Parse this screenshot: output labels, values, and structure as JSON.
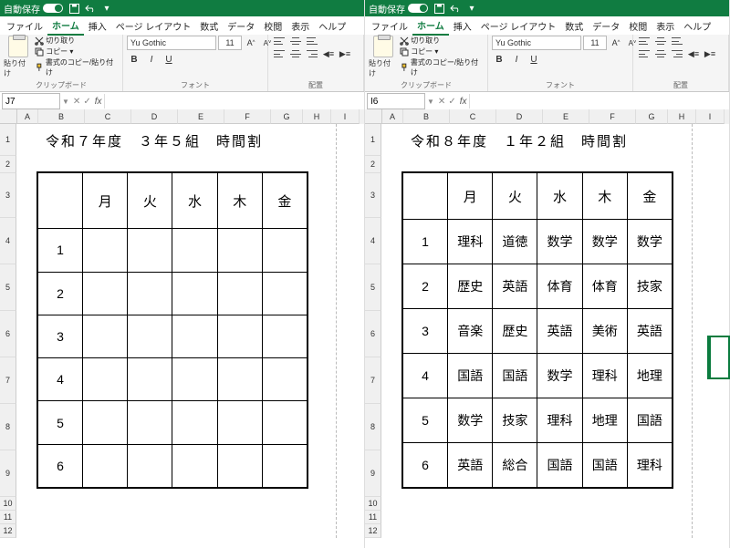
{
  "app": {
    "auto_save_label": "自動保存",
    "auto_save_state": "オン●"
  },
  "tabs": [
    "ファイル",
    "ホーム",
    "挿入",
    "ページ レイアウト",
    "数式",
    "データ",
    "校閲",
    "表示",
    "ヘルプ"
  ],
  "active_tab": "ホーム",
  "ribbon": {
    "clipboard_label": "クリップボード",
    "paste_label": "貼り付け",
    "cut": "切り取り",
    "copy": "コピー ▾",
    "format_painter": "書式のコピー/貼り付け",
    "font_label": "フォント",
    "font_name": "Yu Gothic",
    "font_size": "11",
    "bold": "B",
    "italic": "I",
    "underline": "U",
    "grow_font": "A^",
    "shrink_font": "A˅",
    "align_label": "配置"
  },
  "left": {
    "cell_ref": "J7",
    "title": "令和７年度　３年５組　時間割",
    "days": [
      "月",
      "火",
      "水",
      "木",
      "金"
    ],
    "periods": [
      "1",
      "2",
      "3",
      "4",
      "5",
      "6"
    ],
    "cells": [
      [
        "",
        "",
        "",
        "",
        ""
      ],
      [
        "",
        "",
        "",
        "",
        ""
      ],
      [
        "",
        "",
        "",
        "",
        ""
      ],
      [
        "",
        "",
        "",
        "",
        ""
      ],
      [
        "",
        "",
        "",
        "",
        ""
      ],
      [
        "",
        "",
        "",
        "",
        ""
      ]
    ]
  },
  "right": {
    "cell_ref": "I6",
    "title": "令和８年度　１年２組　時間割",
    "days": [
      "月",
      "火",
      "水",
      "木",
      "金"
    ],
    "periods": [
      "1",
      "2",
      "3",
      "4",
      "5",
      "6"
    ],
    "cells": [
      [
        "理科",
        "道徳",
        "数学",
        "数学",
        "数学"
      ],
      [
        "歴史",
        "英語",
        "体育",
        "体育",
        "技家"
      ],
      [
        "音楽",
        "歴史",
        "英語",
        "美術",
        "英語"
      ],
      [
        "国語",
        "国語",
        "数学",
        "理科",
        "地理"
      ],
      [
        "数学",
        "技家",
        "理科",
        "地理",
        "国語"
      ],
      [
        "英語",
        "総合",
        "国語",
        "国語",
        "理科"
      ]
    ]
  },
  "columns": [
    "A",
    "B",
    "C",
    "D",
    "E",
    "F",
    "G",
    "H",
    "I"
  ],
  "row_numbers": [
    "1",
    "2",
    "3",
    "4",
    "5",
    "6",
    "7",
    "8",
    "9",
    "10",
    "11",
    "12"
  ],
  "chart_data": {
    "type": "table",
    "tables": [
      {
        "title": "令和７年度　３年５組　時間割",
        "columns": [
          "",
          "月",
          "火",
          "水",
          "木",
          "金"
        ],
        "rows": [
          [
            "1",
            "",
            "",
            "",
            "",
            ""
          ],
          [
            "2",
            "",
            "",
            "",
            "",
            ""
          ],
          [
            "3",
            "",
            "",
            "",
            "",
            ""
          ],
          [
            "4",
            "",
            "",
            "",
            "",
            ""
          ],
          [
            "5",
            "",
            "",
            "",
            "",
            ""
          ],
          [
            "6",
            "",
            "",
            "",
            "",
            ""
          ]
        ]
      },
      {
        "title": "令和８年度　１年２組　時間割",
        "columns": [
          "",
          "月",
          "火",
          "水",
          "木",
          "金"
        ],
        "rows": [
          [
            "1",
            "理科",
            "道徳",
            "数学",
            "数学",
            "数学"
          ],
          [
            "2",
            "歴史",
            "英語",
            "体育",
            "体育",
            "技家"
          ],
          [
            "3",
            "音楽",
            "歴史",
            "英語",
            "美術",
            "英語"
          ],
          [
            "4",
            "国語",
            "国語",
            "数学",
            "理科",
            "地理"
          ],
          [
            "5",
            "数学",
            "技家",
            "理科",
            "地理",
            "国語"
          ],
          [
            "6",
            "英語",
            "総合",
            "国語",
            "国語",
            "理科"
          ]
        ]
      }
    ]
  }
}
